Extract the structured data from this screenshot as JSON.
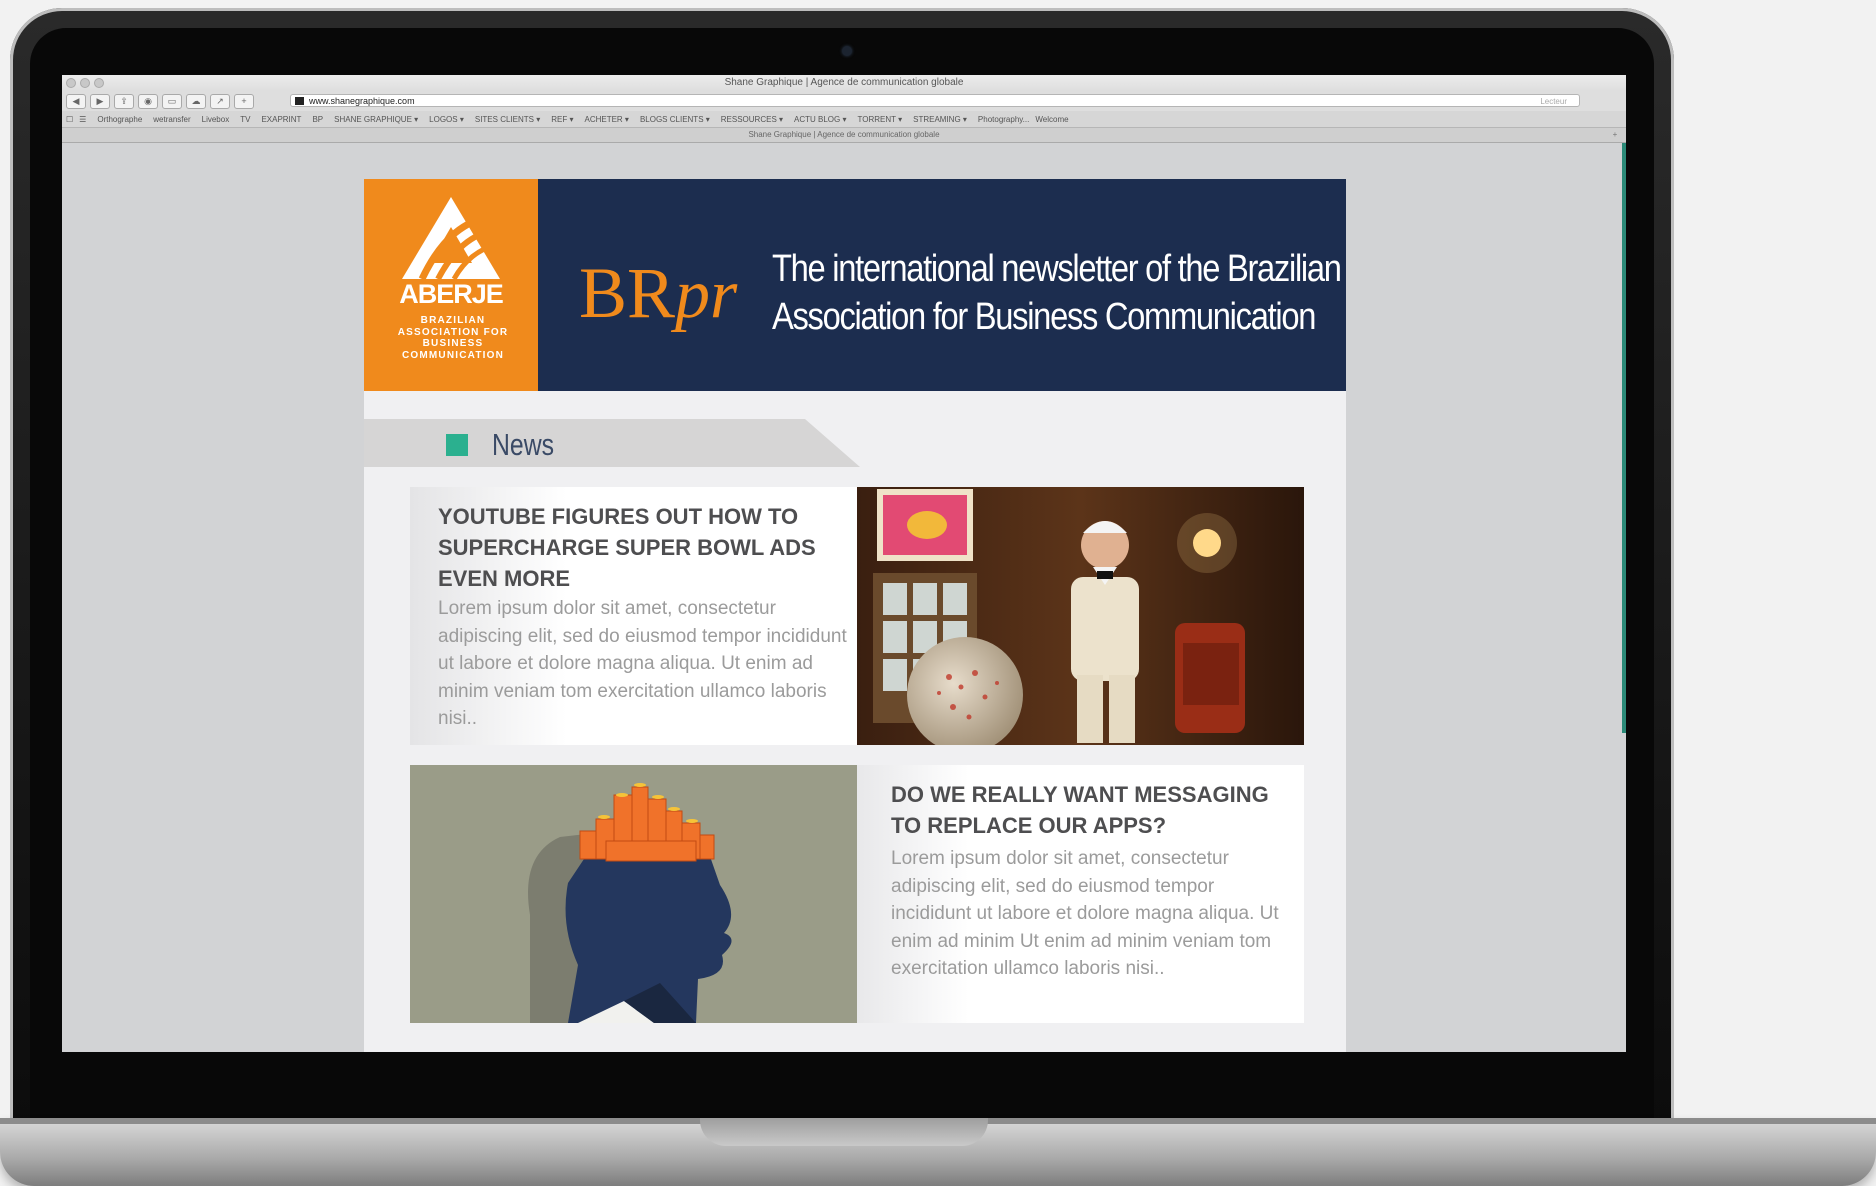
{
  "browser": {
    "window_title": "Shane Graphique | Agence de communication globale",
    "url": "www.shanegraphique.com",
    "reader_label": "Lecteur",
    "bookmarks": [
      "Orthographe",
      "wetransfer",
      "Livebox",
      "TV",
      "EXAPRINT",
      "BP",
      "SHANE GRAPHIQUE ▾",
      "LOGOS ▾",
      "SITES CLIENTS ▾",
      "REF ▾",
      "ACHETER ▾",
      "BLOGS CLIENTS ▾",
      "RESSOURCES ▾",
      "ACTU BLOG ▾",
      "TORRENT ▾",
      "STREAMING ▾",
      "Photography...",
      "Welcome"
    ],
    "tab_title": "Shane Graphique | Agence de communication globale"
  },
  "newsletter": {
    "logo_word": "ABERJE",
    "logo_subtitle": "BRAZILIAN ASSOCIATION FOR BUSINESS COMMUNICATION",
    "brand_main": "BR",
    "brand_italic": "pr",
    "tagline_line1": "The international newsletter of the Brazilian",
    "tagline_line2": "Association for Business Communication",
    "section_label": "News",
    "articles": [
      {
        "title": "YOUTUBE FIGURES OUT HOW TO SUPERCHARGE SUPER BOWL ADS EVEN MORE",
        "body": "Lorem ipsum dolor sit amet, consectetur adipiscing elit, sed do eiusmod tempor incididunt ut labore et dolore magna aliqua. Ut enim ad minim veniam tom exercitation ullamco laboris nisi.."
      },
      {
        "title": "DO WE REALLY WANT MESSAGING TO REPLACE OUR APPS?",
        "body": "Lorem ipsum dolor sit amet, consectetur adipiscing elit, sed do eiusmod tempor incididunt ut labore et dolore magna aliqua. Ut enim ad minim Ut enim ad minim veniam tom exercitation ullamco laboris nisi.."
      }
    ]
  },
  "colors": {
    "brand_orange": "#f08a1c",
    "header_navy": "#1c2d4f",
    "news_accent": "#2bb08f"
  }
}
